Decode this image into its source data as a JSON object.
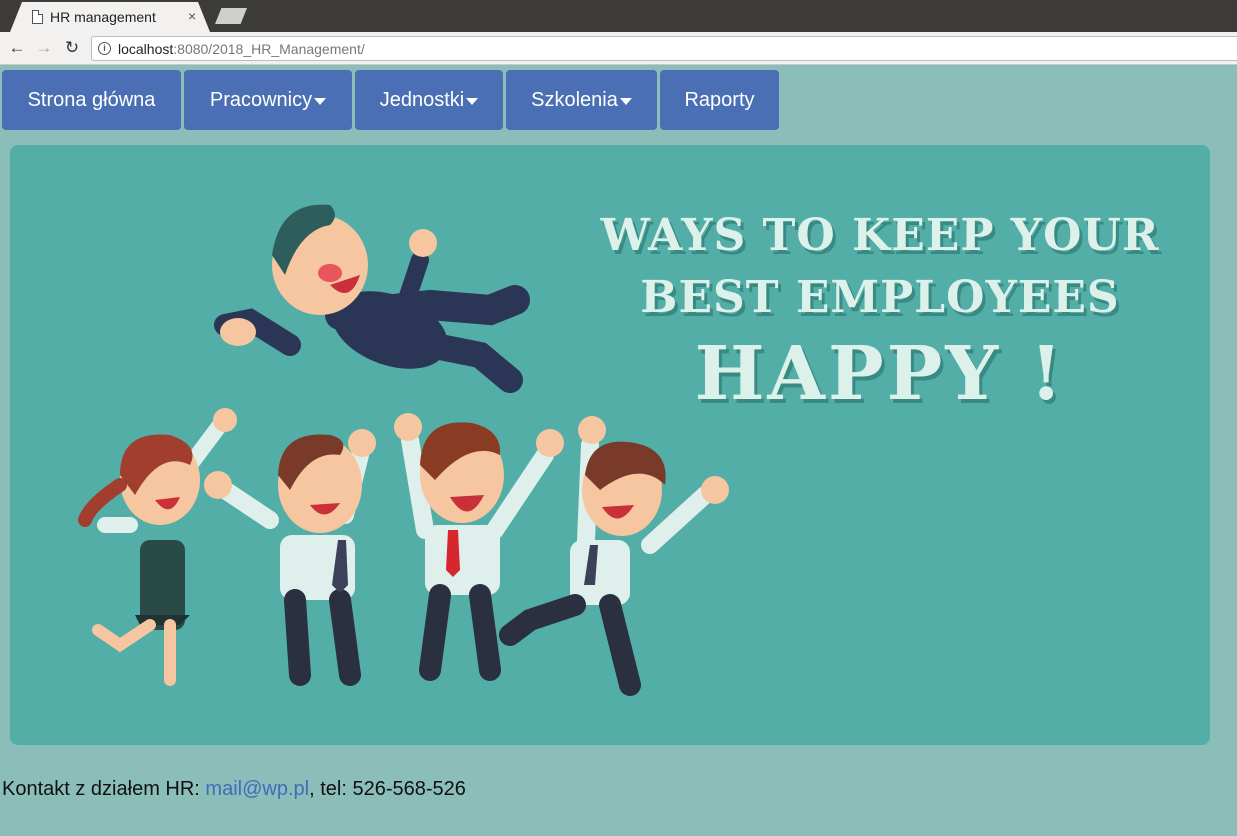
{
  "browser": {
    "tab_title": "HR management",
    "tab_close": "×",
    "url_host": "localhost",
    "url_rest": ":8080/2018_HR_Management/"
  },
  "nav": {
    "items": [
      {
        "label": "Strona główna",
        "dropdown": false
      },
      {
        "label": "Pracownicy",
        "dropdown": true
      },
      {
        "label": "Jednostki",
        "dropdown": true
      },
      {
        "label": "Szkolenia",
        "dropdown": true
      },
      {
        "label": "Raporty",
        "dropdown": false
      }
    ]
  },
  "banner": {
    "line1": "WAYS TO KEEP YOUR",
    "line2": "BEST EMPLOYEES",
    "line3": "HAPPY !"
  },
  "footer": {
    "prefix": "Kontakt z działem HR: ",
    "email": "mail@wp.pl",
    "suffix": ", tel: 526-568-526"
  },
  "colors": {
    "page_bg": "#8bbdb9",
    "nav_bg": "#4a6fb5",
    "banner_bg": "#53aea7",
    "link": "#3f6dba"
  }
}
